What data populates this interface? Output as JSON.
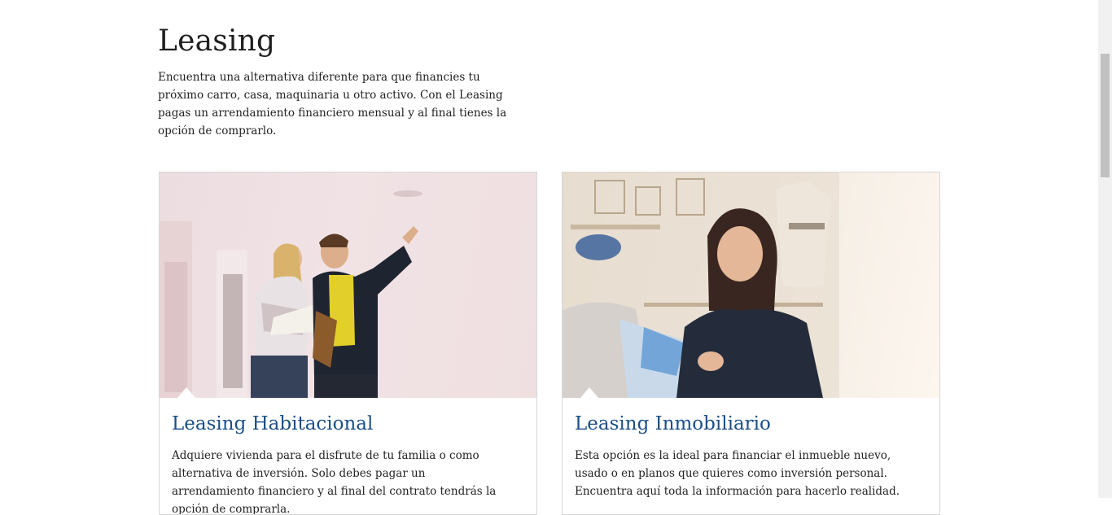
{
  "page": {
    "title": "Leasing",
    "intro": "Encuentra una alternativa diferente para que financies tu próximo carro, casa, maquinaria u otro activo. Con el Leasing pagas un arrendamiento financiero mensual y al final tienes la opción de comprarlo."
  },
  "cards": [
    {
      "title": "Leasing Habitacional",
      "text": "Adquiere vivienda para el disfrute de tu familia o como alternativa de inversión. Solo debes pagar un arrendamiento financiero y al final del contrato tendrás la opción de comprarla."
    },
    {
      "title": "Leasing Inmobiliario",
      "text": "Esta opción es la ideal para financiar el inmueble nuevo, usado o en planos que quieres como inversión personal. Encuentra aquí toda la información para hacerlo realidad."
    }
  ],
  "colors": {
    "card_title": "#1a4f86",
    "text": "#222222",
    "border": "#d7d7d7"
  }
}
